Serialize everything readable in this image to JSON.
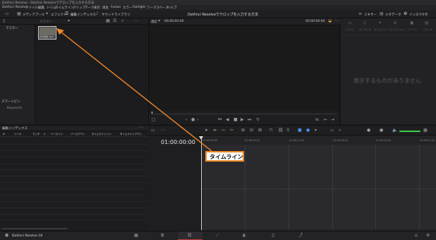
{
  "titlebar": {
    "text": "DaVinci Resolve - DaVinci Resolveでテロップを入力する方法"
  },
  "menubar": {
    "items": [
      "DaVinci Resolve",
      "ファイル",
      "編集",
      "トリム",
      "タイムライン",
      "クリップ",
      "マーク",
      "表示",
      "再生",
      "Fusion",
      "カラー",
      "Fairlight",
      "ワークスペース",
      "ヘルプ"
    ]
  },
  "toolbar": {
    "media_pool": "メディアプール",
    "effects": "エフェクト",
    "edit_index": "編集インデックス",
    "sound_library": "サウンドライブラリ",
    "project_title": "DaVinci Resolveでテロップを入力する方法",
    "mixer": "ミキサー",
    "metadata": "メタデータ",
    "inspector": "インスペクタ"
  },
  "media_pool": {
    "bin_title": "マスター",
    "smart_bin": "スマートビン",
    "keywords": "Keywords",
    "clip_label": "背景画像.mp4",
    "search_placeholder": "マスター"
  },
  "viewer": {
    "fit": "適応",
    "timecode_left": "00:00:00:00",
    "timecode_right": "00:00:00:00"
  },
  "inspector": {
    "tabs": [
      "ビデオ",
      "オーディオ",
      "エフェクト",
      "トランジション",
      "イメージ",
      "ファイル"
    ],
    "empty_message": "表示するものがありません"
  },
  "edit_index": {
    "title": "編集インデックス",
    "columns": [
      "#",
      "リール",
      "マッチ",
      "V",
      "ソースイン",
      "ソースアウト",
      "タイムラインイン",
      "タイムラインアウト"
    ]
  },
  "timeline": {
    "timecode": "01:00:00:00",
    "ticks": [
      "01:00:00:00",
      "01:00:05:12",
      "01:00:11:00",
      "01:00:16:12",
      "01:00:22:00",
      "01:00:27:12"
    ]
  },
  "annotation": {
    "label": "タイムライン",
    "color": "#f28a24"
  },
  "bottombar": {
    "app_name": "DaVinci Resolve 18"
  }
}
